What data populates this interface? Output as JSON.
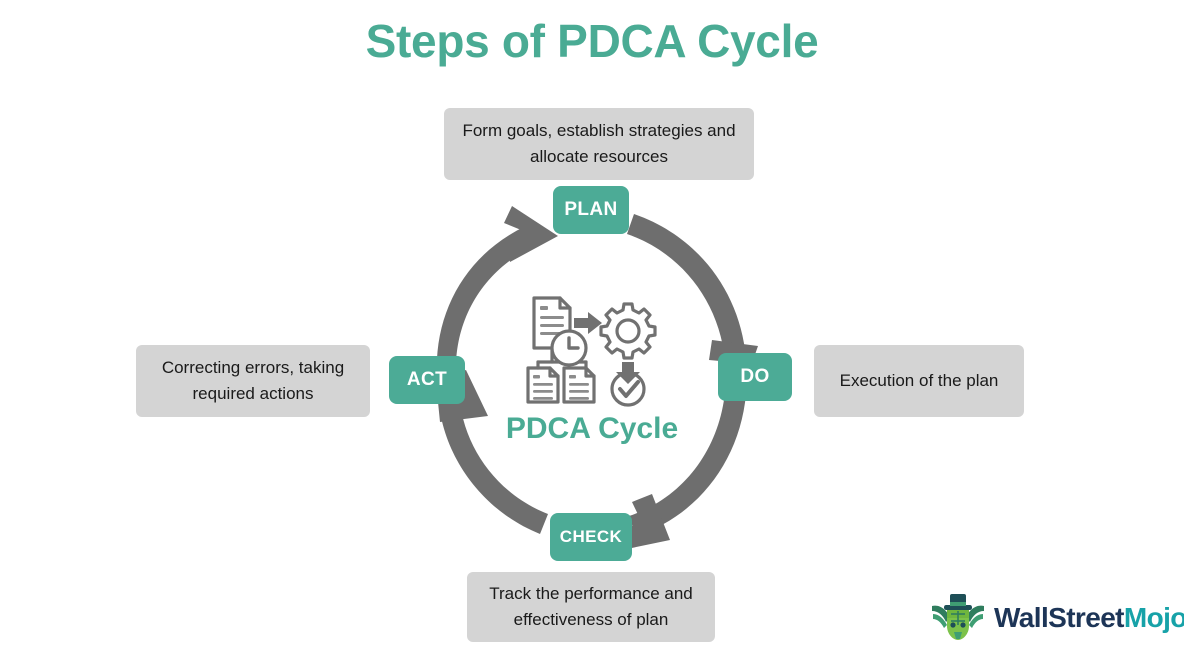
{
  "title": "Steps of PDCA Cycle",
  "center": {
    "label": "PDCA Cycle",
    "icon_name": "process-workflow-icon"
  },
  "colors": {
    "accent_teal": "#4cab96",
    "title_teal": "#4aab94",
    "box_gray": "#d4d4d4",
    "arrow_gray": "#6e6e6e",
    "text_dark": "#1a1a1a",
    "brand_dark": "#1d3557",
    "brand_teal": "#17a2a8"
  },
  "stages": [
    {
      "id": "plan",
      "badge": "PLAN",
      "description": "Form goals, establish strategies and allocate resources"
    },
    {
      "id": "do",
      "badge": "DO",
      "description": "Execution of the plan"
    },
    {
      "id": "check",
      "badge": "CHECK",
      "description": "Track the performance and effectiveness of plan"
    },
    {
      "id": "act",
      "badge": "ACT",
      "description": "Correcting errors, taking required actions"
    }
  ],
  "arrows": [
    {
      "id": "act-to-plan",
      "from": "ACT",
      "to": "PLAN"
    },
    {
      "id": "plan-to-do",
      "from": "PLAN",
      "to": "DO"
    },
    {
      "id": "do-to-check",
      "from": "DO",
      "to": "CHECK"
    },
    {
      "id": "check-to-act",
      "from": "CHECK",
      "to": "ACT"
    }
  ],
  "brand": {
    "name_part1": "WallStreet",
    "name_part2": "Mojo",
    "mark_name": "bull-mascot-logo"
  }
}
